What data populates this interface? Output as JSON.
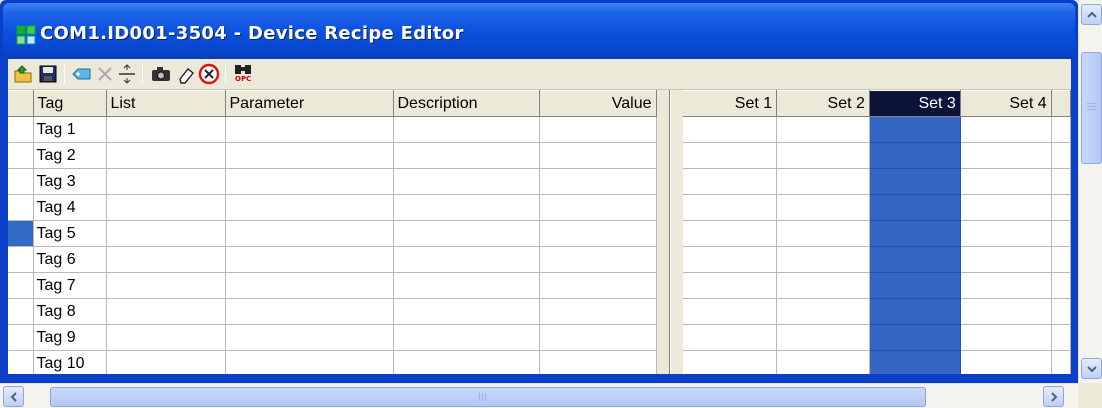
{
  "window": {
    "title": "COM1.ID001-3504 - Device Recipe Editor",
    "title_color": "#ffffff",
    "titlebar_color": "#0c52de"
  },
  "toolbar": {
    "buttons": [
      {
        "name": "open-icon"
      },
      {
        "name": "save-icon"
      },
      {
        "name": "insert-tag-icon"
      },
      {
        "name": "delete-tag-icon"
      },
      {
        "name": "insert-set-icon"
      },
      {
        "name": "snapshot-icon"
      },
      {
        "name": "clear-icon"
      },
      {
        "name": "cancel-icon"
      },
      {
        "name": "find-opc-icon"
      }
    ],
    "opc_label": "OPC"
  },
  "left_grid": {
    "columns": [
      "Tag",
      "List",
      "Parameter",
      "Description",
      "Value"
    ],
    "rows": [
      "Tag 1",
      "Tag 2",
      "Tag 3",
      "Tag 4",
      "Tag 5",
      "Tag 6",
      "Tag 7",
      "Tag 8",
      "Tag 9",
      "Tag 10"
    ],
    "selected_row": "Tag 5"
  },
  "right_grid": {
    "columns": [
      "Set 1",
      "Set 2",
      "Set 3",
      "Set 4"
    ],
    "selected_column": "Set 3",
    "selection_color": "#3566c4"
  }
}
